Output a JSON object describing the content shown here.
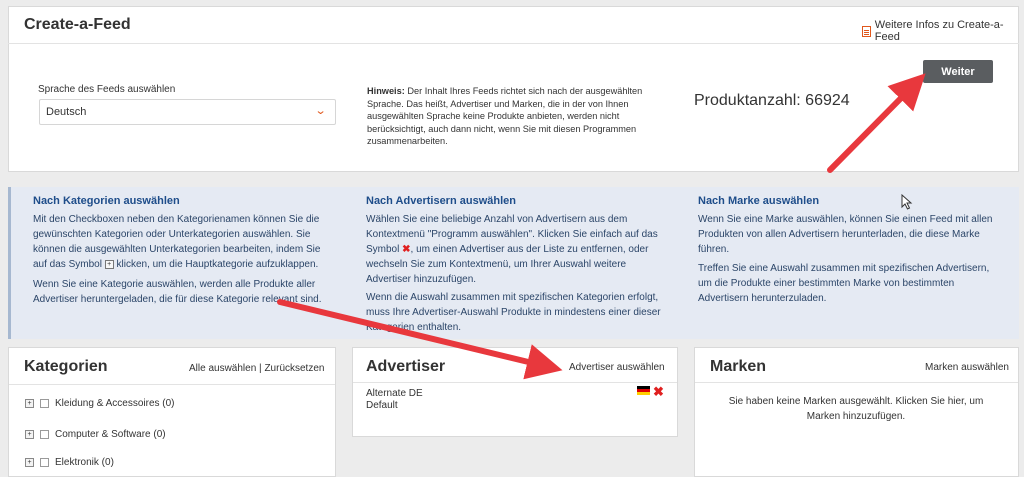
{
  "header": {
    "title": "Create-a-Feed",
    "info_link": "Weitere Infos zu Create-a-Feed",
    "info_icon": "document-icon"
  },
  "language": {
    "label": "Sprache des Feeds auswählen",
    "selected": "Deutsch"
  },
  "hint": {
    "bold": "Hinweis:",
    "text": " Der Inhalt Ihres Feeds richtet sich nach der ausgewählten Sprache. Das heißt, Advertiser und Marken, die in der von Ihnen ausgewählten Sprache keine Produkte anbieten, werden nicht berücksichtigt, auch dann nicht, wenn Sie mit diesen Programmen zusammenarbeiten."
  },
  "product_count": "Produktanzahl: 66924",
  "weiter_label": "Weiter",
  "info": {
    "col1": {
      "title": "Nach Kategorien auswählen",
      "p1a": "Mit den Checkboxen neben den Kategorienamen können Sie die gewünschten Kategorien oder Unterkategorien auswählen. Sie können die ausgewählten Unterkategorien bearbeiten, indem Sie auf das Symbol",
      "p1b": "klicken, um die Hauptkategorie aufzuklappen.",
      "p2": "Wenn Sie eine Kategorie auswählen, werden alle Produkte aller Advertiser heruntergeladen, die für diese Kategorie relevant sind."
    },
    "col2": {
      "title": "Nach Advertisern auswählen",
      "p1a": "Wählen Sie eine beliebige Anzahl von Advertisern aus dem Kontextmenü \"Programm auswählen\". Klicken Sie einfach auf das Symbol",
      "p1b": ", um einen Advertiser aus der Liste zu entfernen, oder wechseln Sie zum Kontextmenü, um Ihrer Auswahl weitere Advertiser hinzuzufügen.",
      "p2": "Wenn die Auswahl zusammen mit spezifischen Kategorien erfolgt, muss Ihre Advertiser-Auswahl Produkte in mindestens einer dieser Kategorien enthalten."
    },
    "col3": {
      "title": "Nach Marke auswählen",
      "p1": "Wenn Sie eine Marke auswählen, können Sie einen Feed mit allen Produkten von allen Advertisern herunterladen, die diese Marke führen.",
      "p2": "Treffen Sie eine Auswahl zusammen mit spezifischen Advertisern, um die Produkte einer bestimmten Marke von bestimmten Advertisern herunterzuladen."
    }
  },
  "kategorien": {
    "title": "Kategorien",
    "select_all": "Alle auswählen",
    "divider": "|",
    "reset": "Zurücksetzen",
    "items": [
      {
        "label": "Kleidung & Accessoires (0)"
      },
      {
        "label": "Computer & Software (0)"
      },
      {
        "label": "Elektronik (0)"
      }
    ]
  },
  "advertiser": {
    "title": "Advertiser",
    "select_link": "Advertiser auswählen",
    "entry_name": "Alternate DE",
    "entry_sub": "Default",
    "flag_icon": "germany-flag-icon",
    "remove_icon": "remove-x-icon"
  },
  "marken": {
    "title": "Marken",
    "select_link": "Marken auswählen",
    "empty_text": "Sie haben keine Marken ausgewählt. Klicken Sie hier, um Marken hinzuzufügen."
  },
  "colors": {
    "accent": "#e0571c",
    "link_blue": "#1e4d8a",
    "button": "#5a5d60",
    "arrow": "#e8383d",
    "info_band": "#e5eaf3"
  }
}
